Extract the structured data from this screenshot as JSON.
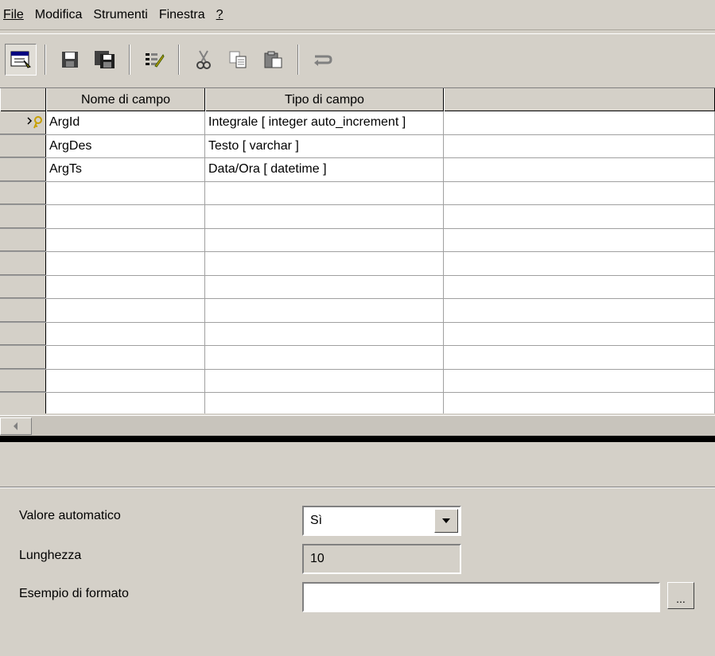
{
  "menu": {
    "file": "File",
    "modifica": "Modifica",
    "strumenti": "Strumenti",
    "finestra": "Finestra",
    "help": "?"
  },
  "toolbar": {
    "icons": [
      "design-view-icon",
      "save-icon",
      "save-all-icon",
      "field-properties-icon",
      "cut-icon",
      "copy-icon",
      "paste-icon",
      "undo-icon"
    ]
  },
  "grid": {
    "headers": {
      "nome": "Nome di campo",
      "tipo": "Tipo di campo",
      "desc": ""
    },
    "rows": [
      {
        "nome": "ArgId",
        "tipo": "Integrale [ integer auto_increment ]",
        "primary_key": true
      },
      {
        "nome": "ArgDes",
        "tipo": "Testo [ varchar ]"
      },
      {
        "nome": "ArgTs",
        "tipo": "Data/Ora [ datetime ]"
      }
    ],
    "empty_rows": 10
  },
  "properties": {
    "valore_automatico_label": "Valore automatico",
    "valore_automatico_value": "Sì",
    "lunghezza_label": "Lunghezza",
    "lunghezza_value": "10",
    "esempio_label": "Esempio di formato",
    "esempio_value": "",
    "browse_label": "..."
  },
  "colors": {
    "window_bg": "#d4d0c8",
    "grid_bg": "#ffffff",
    "key_icon": "#c8a000"
  }
}
